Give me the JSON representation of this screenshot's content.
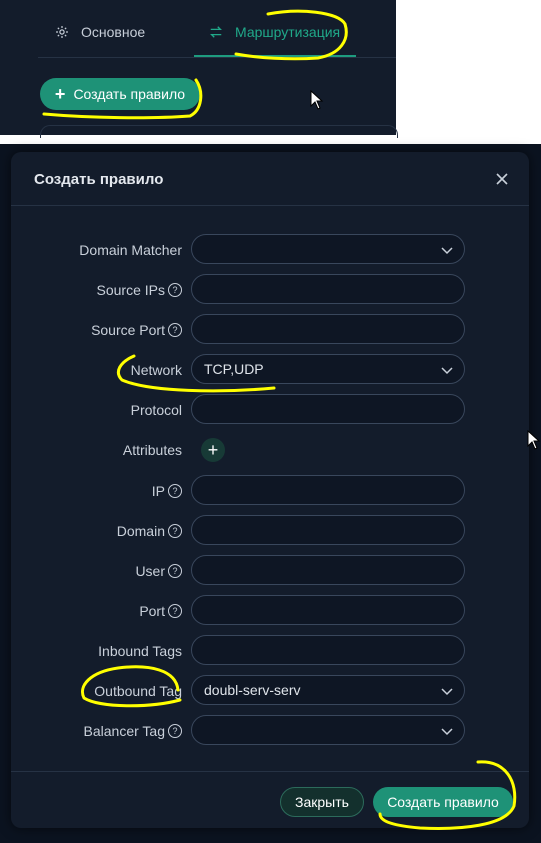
{
  "top": {
    "tabs": [
      {
        "label": "Основное",
        "icon": "gear-icon"
      },
      {
        "label": "Маршрутизация",
        "icon": "route-icon",
        "active": true
      }
    ],
    "create_button": "Создать правило"
  },
  "modal": {
    "title": "Создать правило",
    "fields": [
      {
        "label": "Domain Matcher",
        "value": "",
        "type": "select"
      },
      {
        "label": "Source IPs",
        "value": "",
        "type": "input",
        "help": true
      },
      {
        "label": "Source Port",
        "value": "",
        "type": "input",
        "help": true
      },
      {
        "label": "Network",
        "value": "TCP,UDP",
        "type": "select"
      },
      {
        "label": "Protocol",
        "value": "",
        "type": "input"
      },
      {
        "label": "Attributes",
        "type": "add"
      },
      {
        "label": "IP",
        "value": "",
        "type": "input",
        "help": true
      },
      {
        "label": "Domain",
        "value": "",
        "type": "input",
        "help": true
      },
      {
        "label": "User",
        "value": "",
        "type": "input",
        "help": true
      },
      {
        "label": "Port",
        "value": "",
        "type": "input",
        "help": true
      },
      {
        "label": "Inbound Tags",
        "value": "",
        "type": "input"
      },
      {
        "label": "Outbound Tag",
        "value": "doubl-serv-serv",
        "type": "select"
      },
      {
        "label": "Balancer Tag",
        "value": "",
        "type": "select",
        "help": true
      }
    ],
    "help_glyph": "?",
    "add_glyph": "+",
    "footer": {
      "close_label": "Закрыть",
      "create_label": "Создать правило"
    }
  },
  "colors": {
    "accent": "#1e9277",
    "panel": "#131c2b",
    "annotation": "#ffff00"
  }
}
